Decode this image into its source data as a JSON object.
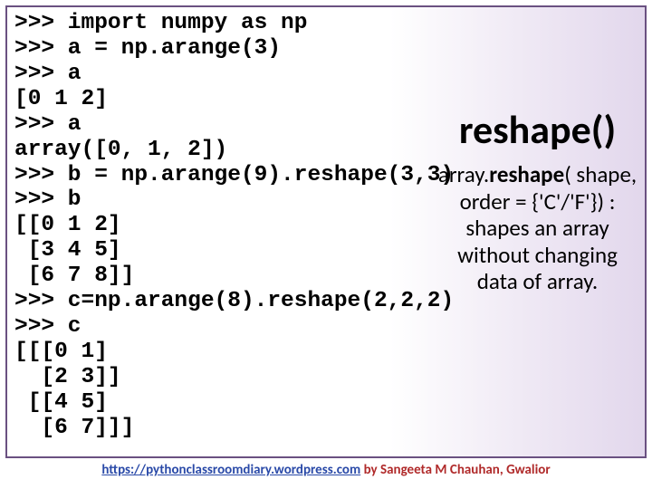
{
  "code": {
    "lines": [
      ">>> import numpy as np",
      ">>> a = np.arange(3)",
      ">>> a",
      "[0 1 2]",
      ">>> a",
      "array([0, 1, 2])",
      ">>> b = np.arange(9).reshape(3,3)",
      ">>> b",
      "[[0 1 2]",
      " [3 4 5]",
      " [6 7 8]]",
      ">>> c=np.arange(8).reshape(2,2,2)",
      ">>> c",
      "[[[0 1]",
      "  [2 3]]",
      " [[4 5]",
      "  [6 7]]]"
    ]
  },
  "side": {
    "title": "reshape()",
    "desc_prefix": "array.",
    "desc_bold": "reshape",
    "desc_rest": "( shape, order = {'C'/'F'}) : shapes an array without changing data of array."
  },
  "footer": {
    "link_text": "https://pythonclassroomdiary.wordpress.com",
    "by_text": " by Sangeeta M Chauhan, Gwalior"
  }
}
